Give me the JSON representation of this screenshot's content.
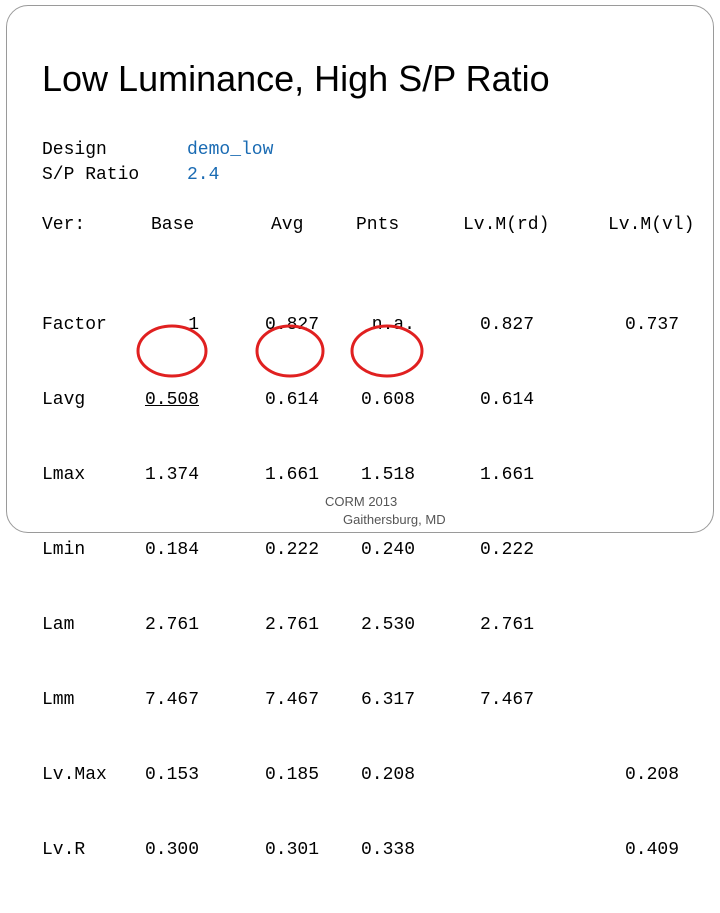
{
  "title": "Low Luminance, High S/P Ratio",
  "design": {
    "label": "Design",
    "value": "demo_low"
  },
  "sp_ratio": {
    "label": "S/P Ratio",
    "value": "2.4"
  },
  "table": {
    "headers": [
      "Ver:",
      "Base",
      "Avg",
      "Pnts",
      "Lv.M(rd)",
      "Lv.M(vl)"
    ],
    "row_labels": [
      "Factor",
      "Lavg",
      "Lmax",
      "Lmin",
      "Lam",
      "Lmm",
      "Lv.Max",
      "Lv.R"
    ],
    "base": [
      "1",
      "0.508",
      "1.374",
      "0.184",
      "2.761",
      "7.467",
      "0.153",
      "0.300"
    ],
    "avg": [
      "0.827",
      "0.614",
      "1.661",
      "0.222",
      "2.761",
      "7.467",
      "0.185",
      "0.301"
    ],
    "pnts": [
      "n.a.",
      "0.608",
      "1.518",
      "0.240",
      "2.530",
      "6.317",
      "0.208",
      "0.338"
    ],
    "lvm_rd": [
      "0.827",
      "0.614",
      "1.661",
      "0.222",
      "2.761",
      "7.467",
      "",
      ""
    ],
    "lvm_vl": [
      "0.737",
      "",
      "",
      "",
      "",
      "",
      "0.208",
      "0.409"
    ]
  },
  "highlight_color": "#e02020",
  "footer": {
    "line1": "CORM 2013",
    "line2": "Gaithersburg, MD"
  }
}
